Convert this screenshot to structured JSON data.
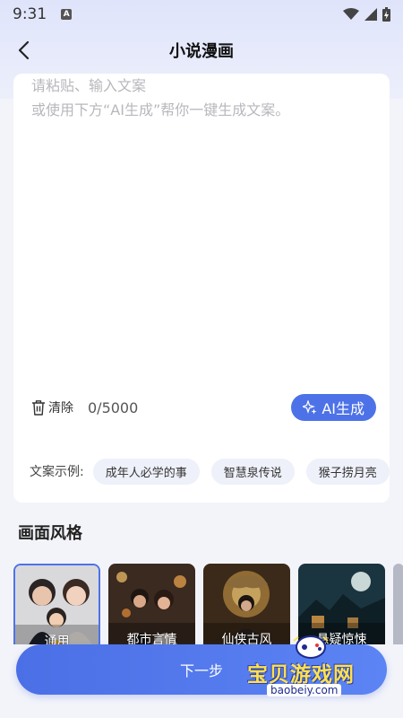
{
  "status": {
    "time": "9:31",
    "app_badge": "A"
  },
  "nav": {
    "title": "小说漫画"
  },
  "editor": {
    "placeholder_line1": "请粘贴、输入文案",
    "placeholder_line2": "或使用下方“AI生成”帮你一键生成文案。",
    "clear_label": "清除",
    "counter": "0/5000",
    "ai_button_label": "AI生成"
  },
  "examples": {
    "label": "文案示例:",
    "items": [
      "成年人必学的事",
      "智慧泉传说",
      "猴子捞月亮"
    ]
  },
  "style_section": {
    "title": "画面风格",
    "items": [
      {
        "label": "通用",
        "selected": true
      },
      {
        "label": "都市言情",
        "selected": false
      },
      {
        "label": "仙侠古风",
        "selected": false
      },
      {
        "label": "悬疑惊悚",
        "selected": false
      }
    ]
  },
  "next_button": {
    "label": "下一步"
  },
  "watermark": {
    "text": "宝贝游戏网",
    "url": "baobeiy.com"
  },
  "colors": {
    "accent": "#4d72e8",
    "background": "#f3f4fa"
  }
}
